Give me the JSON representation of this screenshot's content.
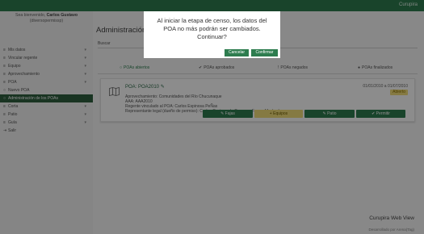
{
  "topbar": {
    "brand": "Curupira"
  },
  "sidebar": {
    "welcome_prefix": "Sea bienvenido, ",
    "welcome_name": "Carlos Gustavo",
    "welcome_user": "(diversopermissp)",
    "items": [
      {
        "label": "Mis datos",
        "icon": "menu-icon",
        "caret": "▾"
      },
      {
        "label": "Vincular regente",
        "icon": "menu-icon",
        "caret": "▾"
      },
      {
        "label": "Equipo",
        "icon": "menu-icon",
        "caret": "▾"
      },
      {
        "label": "Aprovechamiento",
        "icon": "menu-icon",
        "caret": "▾"
      },
      {
        "label": "POA",
        "icon": "menu-icon",
        "caret": "▾"
      },
      {
        "label": "Nuevo POA",
        "icon": "circle-icon",
        "caret": ""
      },
      {
        "label": "Administración de los POAs",
        "icon": "circle-icon",
        "caret": ""
      },
      {
        "label": "Corta",
        "icon": "menu-icon",
        "caret": "▾"
      },
      {
        "label": "Patio",
        "icon": "menu-icon",
        "caret": "▾"
      },
      {
        "label": "Guía",
        "icon": "menu-icon",
        "caret": "▾"
      },
      {
        "label": "Salir",
        "icon": "logout-icon",
        "caret": ""
      }
    ]
  },
  "main": {
    "title": "Administración d",
    "search_label": "Buscar",
    "tabs": [
      {
        "label": "POAs abiertos",
        "icon": "○"
      },
      {
        "label": "POAs aprobados",
        "icon": "✔"
      },
      {
        "label": "POAs negados",
        "icon": "!"
      },
      {
        "label": "POAs finalizados",
        "icon": "●"
      }
    ]
  },
  "card": {
    "title": "POA: POA2010",
    "date_range": "01/01/2010 a 01/07/2010",
    "status": "Abierto",
    "lines": [
      "Aprovechamiento: Comunidades del Río Chucunaque",
      "AAA: AAA2010",
      "Regente vinculado al POA: Carlos Espinosa PeÑas",
      "Representante legal (dueño de permiso): Carlos Gustavo de Camargo Ferraz Machado"
    ],
    "actions": [
      {
        "label": "Fajas",
        "icon": "✎"
      },
      {
        "label": "Equipos",
        "icon": "+"
      },
      {
        "label": "Patio",
        "icon": "✎"
      },
      {
        "label": "Permitir",
        "icon": "✔"
      }
    ]
  },
  "footer": {
    "brand": "Curupira Web View",
    "dev": "Desarrollado por Arena(Tag)"
  },
  "dialog": {
    "message_lines": [
      "Al iniciar la etapa de censo, los datos del",
      "POA no más podrán ser cambiados.",
      "Continuar?"
    ],
    "cancel_label": "Cancelar",
    "confirm_label": "Confirmar"
  }
}
